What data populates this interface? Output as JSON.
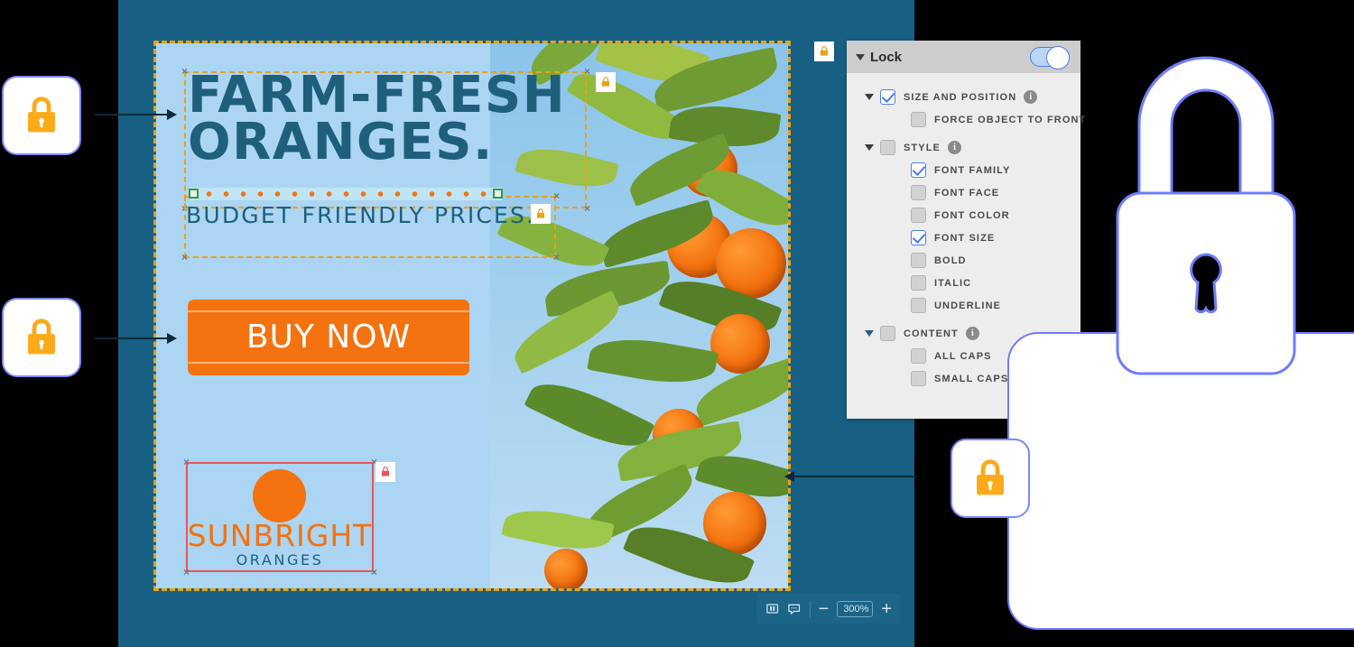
{
  "canvas": {
    "headline": "FARM-FRESH\nORANGES.",
    "subheadline": "BUDGET  FRIENDLY  PRICES.",
    "cta_label": "BUY NOW",
    "logo": {
      "name": "SUNBRIGHT",
      "tagline": "ORANGES"
    }
  },
  "zoombar": {
    "layout_icon": "layout-icon",
    "comment_icon": "comment-icon",
    "zoom_out_label": "−",
    "zoom_value": "300%",
    "zoom_in_label": "+"
  },
  "panel": {
    "title": "Lock",
    "collapse_icon": "triangle-down-icon",
    "toggle_state": "on",
    "groups": [
      {
        "label": "SIZE AND POSITION",
        "checked": true,
        "has_info": true,
        "children": [
          {
            "label": "FORCE OBJECT TO FRONT",
            "checked": false
          }
        ]
      },
      {
        "label": "STYLE",
        "checked": false,
        "has_info": true,
        "children": [
          {
            "label": "FONT FAMILY",
            "checked": true
          },
          {
            "label": "FONT FACE",
            "checked": false
          },
          {
            "label": "FONT COLOR",
            "checked": false
          },
          {
            "label": "FONT SIZE",
            "checked": true
          },
          {
            "label": "BOLD",
            "checked": false
          },
          {
            "label": "ITALIC",
            "checked": false
          },
          {
            "label": "UNDERLINE",
            "checked": false
          }
        ]
      },
      {
        "label": "CONTENT",
        "checked": false,
        "has_info": true,
        "children": [
          {
            "label": "ALL CAPS",
            "checked": false
          },
          {
            "label": "SMALL CAPS",
            "checked": false
          }
        ]
      }
    ],
    "info_glyph": "i"
  },
  "colors": {
    "app_background": "#186083",
    "canvas_sky": "#abd5f2",
    "brand_orange": "#f4720f",
    "brand_teal": "#1f5f7c",
    "selection_orange": "#e8a317",
    "selection_red": "#e8545a",
    "selection_green": "#2f9e44",
    "accent_blue": "#6e7dfb",
    "lock_amber": "#fbaa19"
  },
  "icons": {
    "lock": "lock-icon",
    "big_lock": "lock-icon",
    "arrow": "arrow-right-icon"
  }
}
